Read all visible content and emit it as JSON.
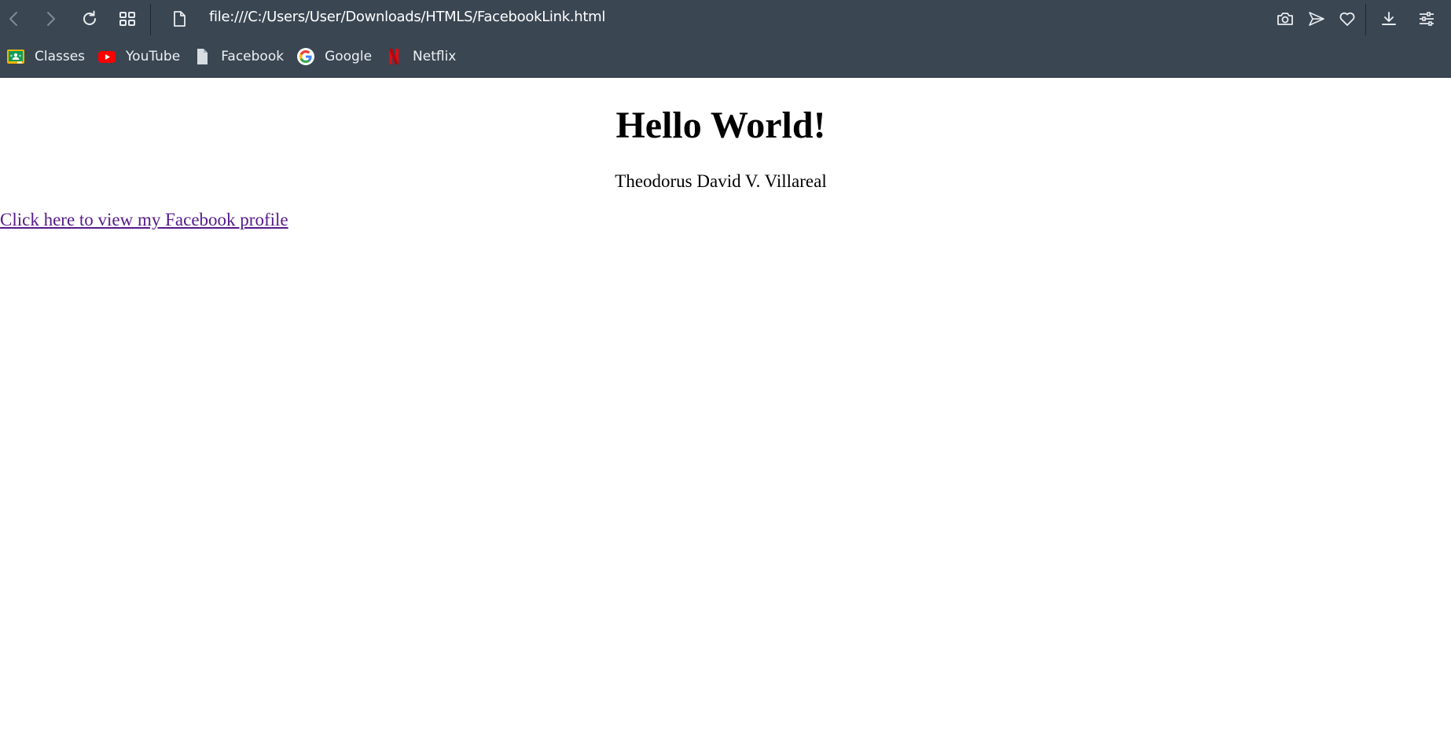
{
  "browser": {
    "url": "file:///C:/Users/User/Downloads/HTMLS/FacebookLink.html",
    "bookmarks": [
      {
        "label": "Classes",
        "icon": "google-classroom-icon"
      },
      {
        "label": "YouTube",
        "icon": "youtube-icon"
      },
      {
        "label": "Facebook",
        "icon": "document-icon"
      },
      {
        "label": "Google",
        "icon": "google-icon"
      },
      {
        "label": "Netflix",
        "icon": "netflix-icon"
      }
    ],
    "colors": {
      "toolbar_bg": "#3a4652",
      "visited_link": "#551a8b"
    }
  },
  "page": {
    "heading": "Hello World!",
    "author": "Theodorus David V. Villareal",
    "link_text": "Click here to view my Facebook profile"
  }
}
